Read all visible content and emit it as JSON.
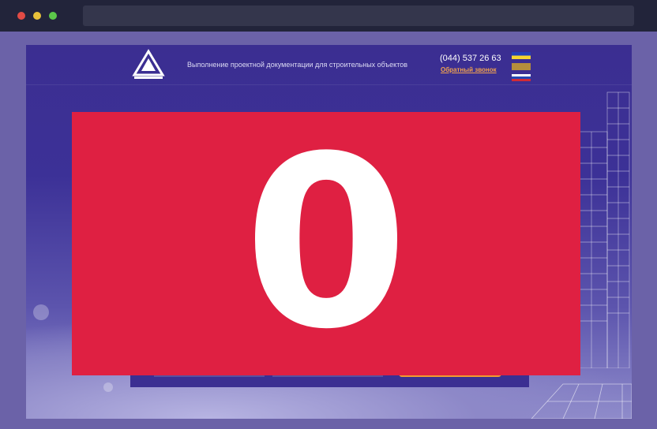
{
  "browser": {
    "window_buttons": [
      "close",
      "minimize",
      "maximize"
    ],
    "colors": {
      "close": "#e14b45",
      "minimize": "#e8c13a",
      "maximize": "#5cc84a"
    }
  },
  "header": {
    "logo_icon": "company-logo-icon",
    "tagline": "Выполнение проектной документации для строительных объектов",
    "phone": "(044) 537 26 63",
    "callback_label": "Обратный звонок",
    "language_flags": [
      "flag-1-icon",
      "flag-2-icon",
      "flag-ru-icon"
    ]
  },
  "overlay": {
    "number": "0",
    "color": "#df2042"
  },
  "colors": {
    "page_bg": "#3c3197",
    "accent": "#f29a30",
    "link": "#f2a24d"
  }
}
